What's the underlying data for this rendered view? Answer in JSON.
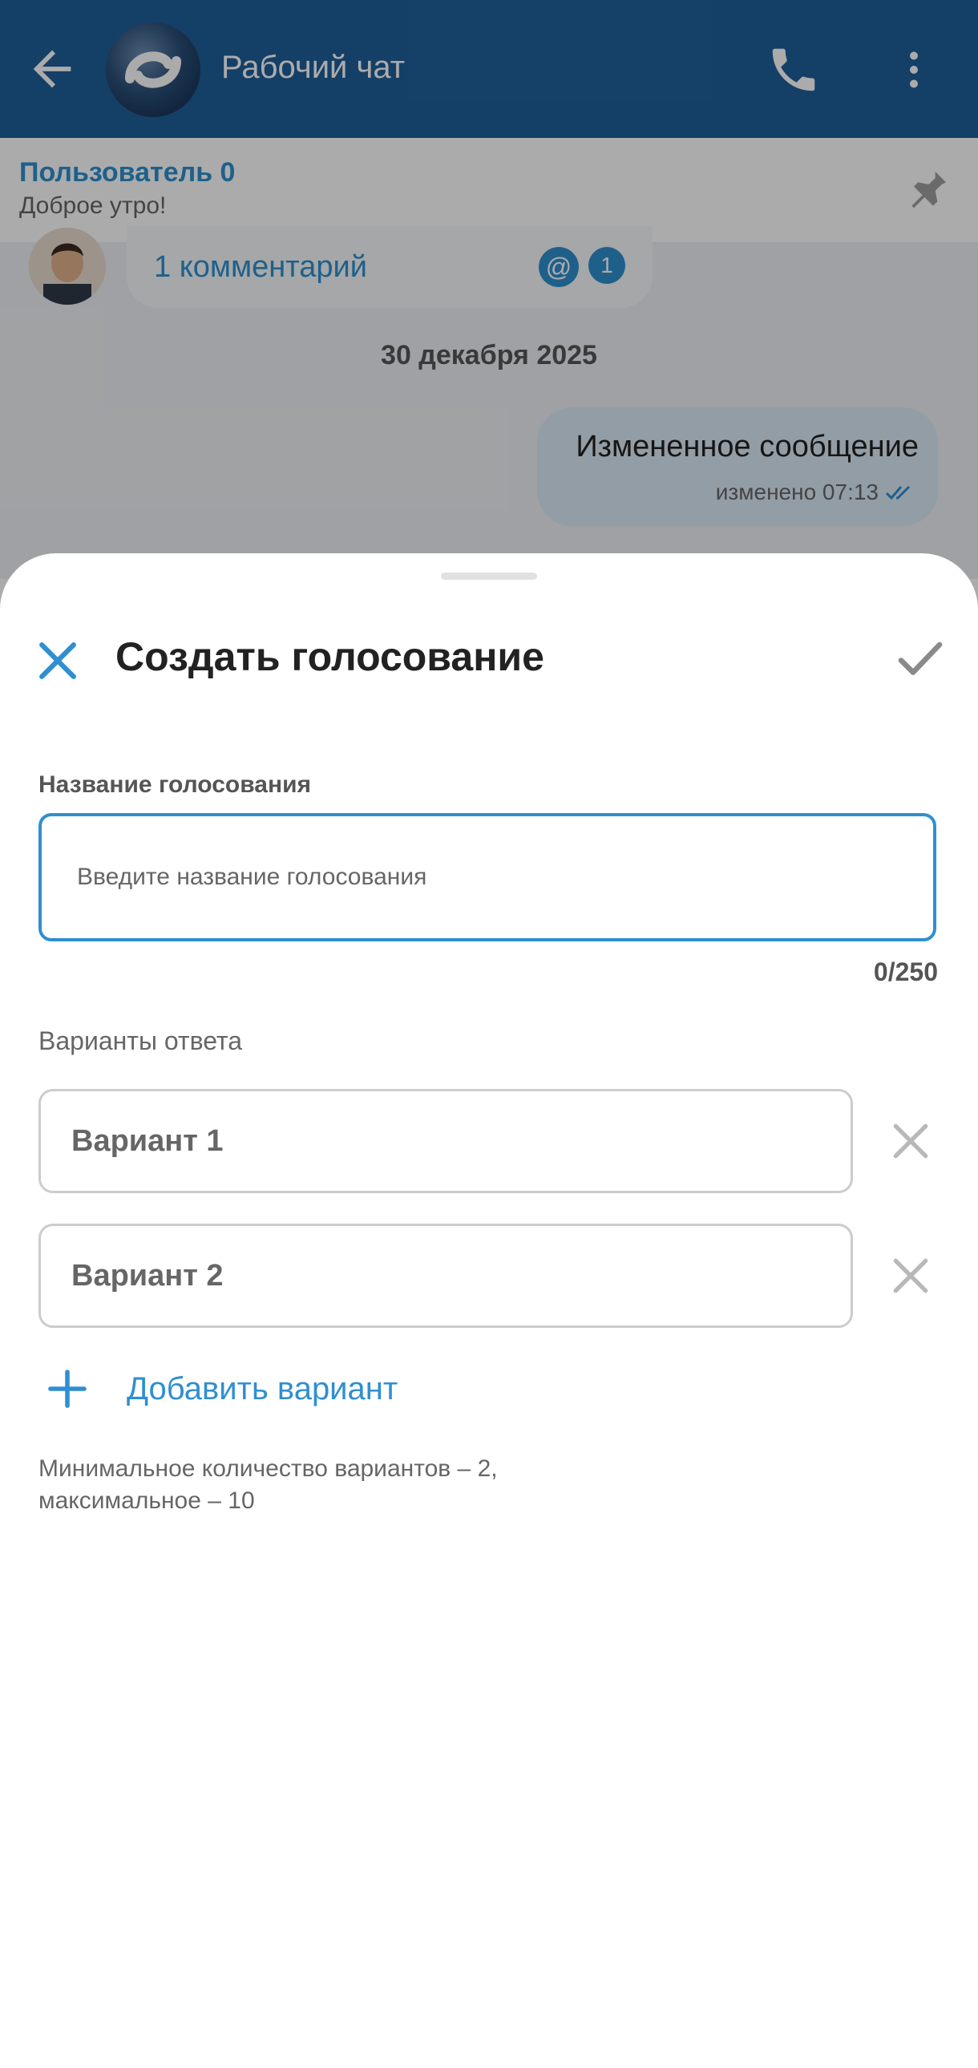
{
  "app_bar": {
    "title": "Рабочий чат"
  },
  "pinned": {
    "author": "Пользователь 0",
    "text": "Доброе утро!"
  },
  "chat": {
    "comment_link": "1 комментарий",
    "mention_badge": "@",
    "comment_count": "1",
    "date_separator": "30 декабря 2025",
    "outgoing_message": "Измененное сообщение",
    "outgoing_meta": "изменено 07:13"
  },
  "sheet": {
    "title": "Создать голосование",
    "poll_name_label": "Название голосования",
    "poll_name_placeholder": "Введите название голосования",
    "char_counter": "0/250",
    "options_label": "Варианты ответа",
    "options": [
      {
        "placeholder": "Вариант 1"
      },
      {
        "placeholder": "Вариант 2"
      }
    ],
    "add_option_label": "Добавить вариант",
    "hint_line1": "Минимальное количество вариантов – 2,",
    "hint_line2": "максимальное – 10"
  },
  "colors": {
    "accent": "#2f8fd0",
    "app_bar": "#1f5f9a"
  }
}
